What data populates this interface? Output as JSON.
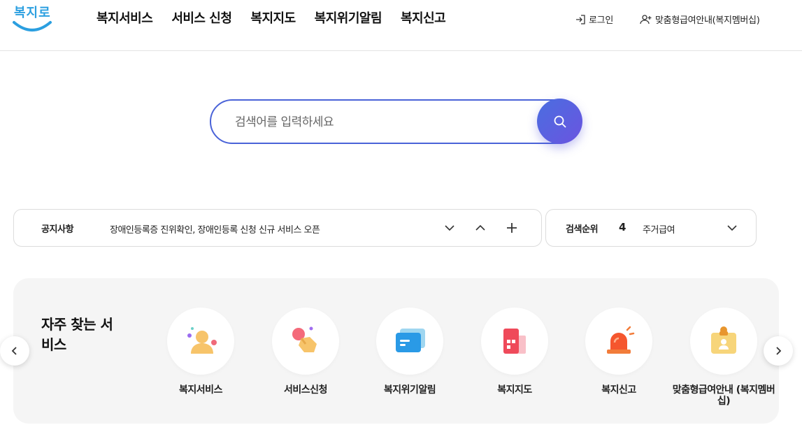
{
  "header": {
    "logo_text": "복지로",
    "nav": [
      "복지서비스",
      "서비스 신청",
      "복지지도",
      "복지위기알림",
      "복지신고"
    ],
    "login_label": "로그인",
    "member_label": "맞춤형급여안내(복지멤버십)"
  },
  "search": {
    "placeholder": "검색어를 입력하세요"
  },
  "notice": {
    "label": "공지사항",
    "text": "장애인등록증 진위확인, 장애인등록 신청 신규 서비스 오픈"
  },
  "rank": {
    "label": "검색순위",
    "number": "4",
    "term": "주거급여"
  },
  "frequent": {
    "title": "자주 찾는 서비스",
    "items": [
      {
        "label": "복지서비스",
        "icon": "person-icon"
      },
      {
        "label": "서비스신청",
        "icon": "hand-tap-icon"
      },
      {
        "label": "복지위기알림",
        "icon": "message-card-icon"
      },
      {
        "label": "복지지도",
        "icon": "building-icon"
      },
      {
        "label": "복지신고",
        "icon": "siren-icon"
      },
      {
        "label": "맞춤형급여안내 (복지멤버십)",
        "icon": "id-card-icon"
      }
    ]
  },
  "colors": {
    "brand_blue": "#2b9fe0",
    "search_border": "#4a63d8",
    "search_button": "#5a62e0"
  }
}
